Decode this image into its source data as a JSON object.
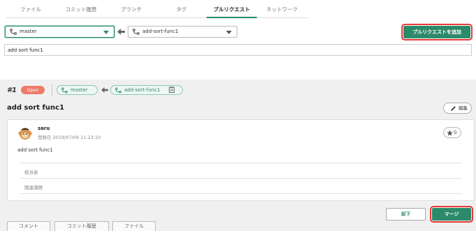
{
  "tabs": [
    {
      "label": "ファイル",
      "active": false
    },
    {
      "label": "コミット履歴",
      "active": false
    },
    {
      "label": "ブランチ",
      "active": false
    },
    {
      "label": "タグ",
      "active": false
    },
    {
      "label": "プルリクエスト",
      "active": true
    },
    {
      "label": "ネットワーク",
      "active": false
    }
  ],
  "compare": {
    "base_branch": "master",
    "compare_branch": "add-sort-func1",
    "add_button": "プルリクエストを追加",
    "title_value": "add sort func1"
  },
  "pr": {
    "number": "#1",
    "status": "Open",
    "base": "master",
    "compare": "add-sort-func1",
    "title": "add sort func1",
    "edit_label": "編集"
  },
  "comment": {
    "user": "saru",
    "date": "登録日 2019/07/09 11:23:10",
    "star_count": "0",
    "body": "add sort func1",
    "rows": [
      "担当者",
      "関連課題"
    ]
  },
  "actions": {
    "cancel": "却下",
    "merge": "マージ"
  },
  "bottom_tabs": [
    "コメント",
    "コミット履歴",
    "ファイル"
  ],
  "colors": {
    "accent": "#2b8a6a",
    "open_badge": "#ee7a6a",
    "highlight": "#e53935"
  }
}
